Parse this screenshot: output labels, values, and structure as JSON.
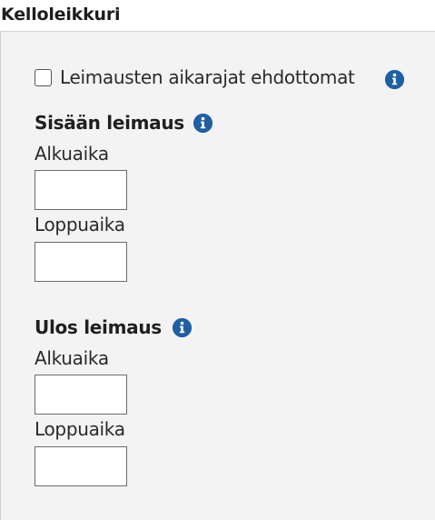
{
  "header": {
    "title": "Kelloleikkuri"
  },
  "options": {
    "strict_limits_label": "Leimausten aikarajat ehdottomat",
    "strict_limits_checked": false
  },
  "sections": [
    {
      "heading": "Sisään leimaus",
      "start_label": "Alkuaika",
      "start_value": "",
      "end_label": "Loppuaika",
      "end_value": ""
    },
    {
      "heading": "Ulos leimaus",
      "start_label": "Alkuaika",
      "start_value": "",
      "end_label": "Loppuaika",
      "end_value": ""
    }
  ],
  "icons": {
    "info": "info-icon"
  },
  "colors": {
    "info_icon": "#1f5fa3",
    "panel_background": "#f3f3f4"
  }
}
